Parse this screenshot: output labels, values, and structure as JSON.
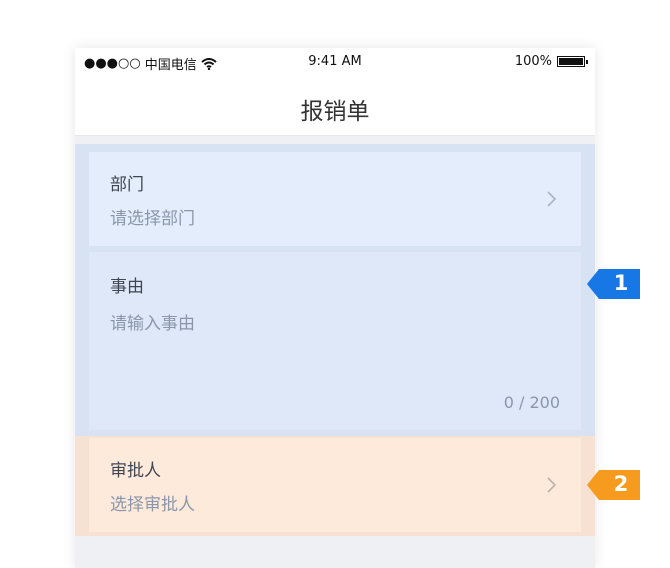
{
  "status_bar": {
    "signal": "●●●○○",
    "carrier": "中国电信",
    "wifi_icon": "wifi-icon",
    "time": "9:41 AM",
    "battery": "100%"
  },
  "nav": {
    "title": "报销单"
  },
  "form": {
    "department": {
      "label": "部门",
      "placeholder": "请选择部门"
    },
    "reason": {
      "label": "事由",
      "placeholder": "请输入事由",
      "counter": "0 / 200"
    },
    "approver": {
      "label": "审批人",
      "placeholder": "选择审批人"
    }
  },
  "annotations": [
    {
      "number": "1",
      "color": "#1677e5"
    },
    {
      "number": "2",
      "color": "#f79b1f"
    }
  ],
  "colors": {
    "band_blue": "#d7e2f2",
    "band_orange": "#f6e1d3"
  }
}
